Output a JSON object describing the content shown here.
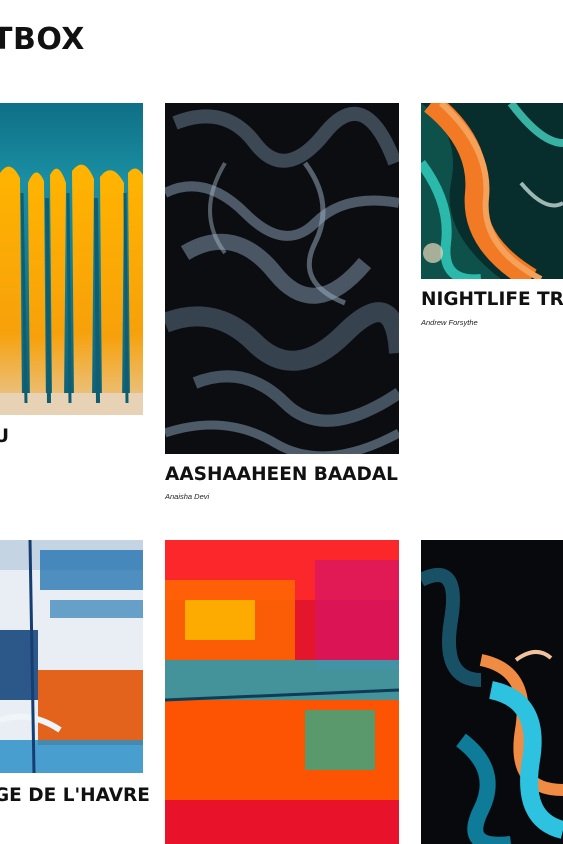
{
  "brand": {
    "name": "TBOX"
  },
  "gallery": {
    "row1": [
      {
        "title": "U",
        "artist": ""
      },
      {
        "title": "AASHAAHEEN BAADAL",
        "artist": "Anaisha Devi"
      },
      {
        "title": "NIGHTLIFE TRA",
        "artist": "Andrew Forsythe"
      }
    ],
    "row2": [
      {
        "title": "GE DE L'HAVRE",
        "artist": ""
      },
      {
        "title": "",
        "artist": ""
      },
      {
        "title": "",
        "artist": ""
      }
    ]
  }
}
